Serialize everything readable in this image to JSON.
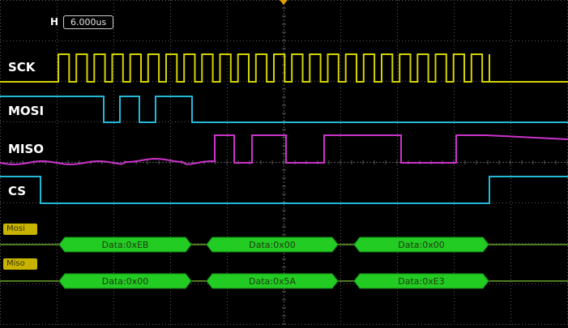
{
  "timebase": {
    "label": "H",
    "value": "6.000us"
  },
  "channels": [
    {
      "name": "SCK",
      "color": "#d4d400"
    },
    {
      "name": "MOSI",
      "color": "#21b9d6"
    },
    {
      "name": "MISO",
      "color": "#cc33cc"
    },
    {
      "name": "CS",
      "color": "#21b9d6"
    }
  ],
  "buses": [
    {
      "name": "Mosi",
      "frames": [
        "Data:0xEB",
        "Data:0x00",
        "Data:0x00"
      ]
    },
    {
      "name": "Miso",
      "frames": [
        "Data:0x00",
        "Data:0x5A",
        "Data:0xE3"
      ]
    }
  ],
  "colors": {
    "grid": "#5a5a5a",
    "trigger_marker": "#e0a000",
    "bus_line": "#7cc43a",
    "packet_fill": "#22cc22",
    "bus_label_bg": "#c8b400"
  }
}
